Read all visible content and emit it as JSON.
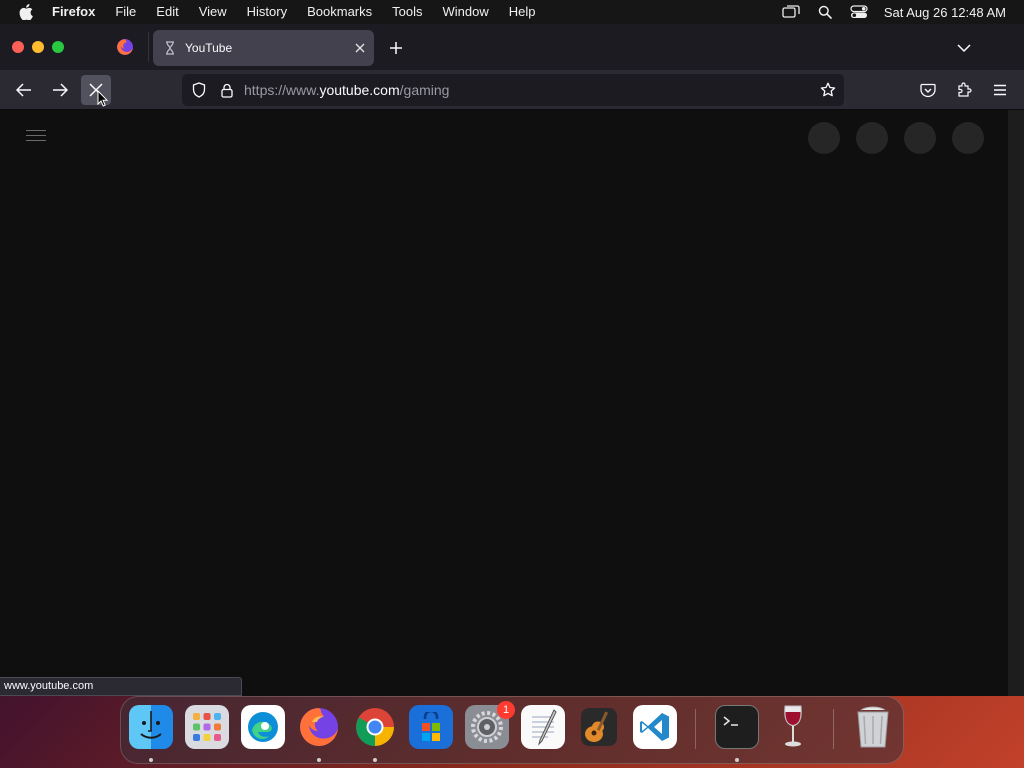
{
  "menubar": {
    "app_name": "Firefox",
    "items": [
      "File",
      "Edit",
      "View",
      "History",
      "Bookmarks",
      "Tools",
      "Window",
      "Help"
    ],
    "clock": "Sat Aug 26  12:48 AM",
    "status_icons": [
      "screen-mirroring-icon",
      "spotlight-search-icon",
      "control-center-icon"
    ]
  },
  "browser": {
    "tab": {
      "title": "YouTube",
      "favicon": "loading-hourglass-icon"
    },
    "url": {
      "prefix": "https://www.",
      "host": "youtube.com",
      "path": "/gaming"
    },
    "status_text": "www.youtube.com"
  },
  "page": {
    "skeleton_avatars": 4
  },
  "dock": {
    "apps": [
      "Finder",
      "Launchpad",
      "Microsoft Edge",
      "Firefox",
      "Google Chrome",
      "Microsoft Store",
      "System Preferences",
      "TextEdit",
      "GarageBand",
      "Visual Studio Code",
      "Terminal",
      "Wine",
      "Trash"
    ],
    "system_preferences_badge": "1"
  },
  "colors": {
    "accent_red": "#fe5f57",
    "accent_yellow": "#febc2e",
    "accent_green": "#28c840",
    "page_bg": "#0f0f0f",
    "toolbar_bg": "#2b2a33"
  }
}
